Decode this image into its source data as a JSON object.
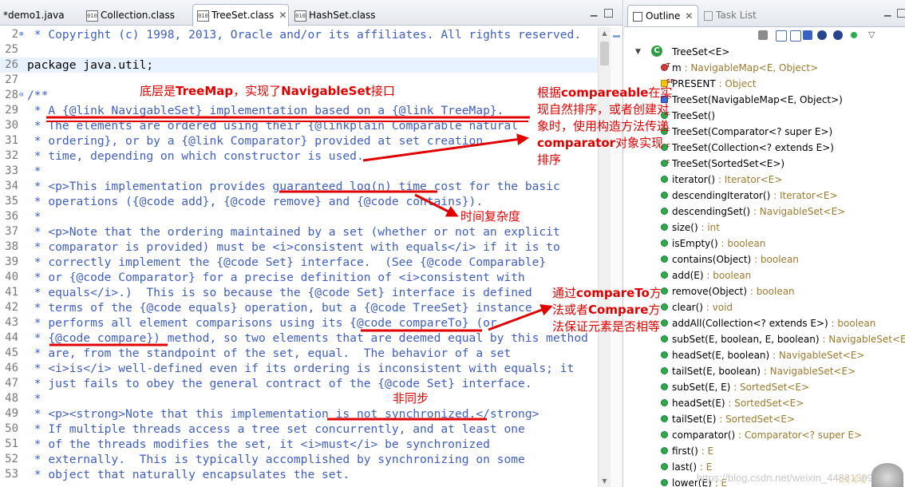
{
  "editor": {
    "tabs": [
      {
        "label": "*demo1.java",
        "icon": "java-file-icon",
        "active": false
      },
      {
        "label": "Collection.class",
        "icon": "class-file-icon",
        "active": false
      },
      {
        "label": "TreeSet.class",
        "icon": "class-file-icon",
        "active": true
      },
      {
        "label": "HashSet.class",
        "icon": "class-file-icon",
        "active": false
      }
    ],
    "close_glyph": "✕",
    "lines": [
      {
        "num": "2",
        "text": " * Copyright (c) 1998, 2013, Oracle and/or its affiliates. All rights reserved.",
        "fold": "⊕"
      },
      {
        "num": "25",
        "text": ""
      },
      {
        "num": "26",
        "text": "package java.util;",
        "highlight": true
      },
      {
        "num": "27",
        "text": ""
      },
      {
        "num": "28",
        "text": "/**",
        "fold": "⊖"
      },
      {
        "num": "29",
        "text": " * A {@link NavigableSet} implementation based on a {@link TreeMap}."
      },
      {
        "num": "30",
        "text": " * The elements are ordered using their {@linkplain Comparable natural"
      },
      {
        "num": "31",
        "text": " * ordering}, or by a {@link Comparator} provided at set creation"
      },
      {
        "num": "32",
        "text": " * time, depending on which constructor is used."
      },
      {
        "num": "33",
        "text": " *"
      },
      {
        "num": "34",
        "text": " * <p>This implementation provides guaranteed log(n) time cost for the basic"
      },
      {
        "num": "35",
        "text": " * operations ({@code add}, {@code remove} and {@code contains})."
      },
      {
        "num": "36",
        "text": " *"
      },
      {
        "num": "37",
        "text": " * <p>Note that the ordering maintained by a set (whether or not an explicit"
      },
      {
        "num": "38",
        "text": " * comparator is provided) must be <i>consistent with equals</i> if it is to"
      },
      {
        "num": "39",
        "text": " * correctly implement the {@code Set} interface.  (See {@code Comparable}"
      },
      {
        "num": "40",
        "text": " * or {@code Comparator} for a precise definition of <i>consistent with"
      },
      {
        "num": "41",
        "text": " * equals</i>.)  This is so because the {@code Set} interface is defined"
      },
      {
        "num": "42",
        "text": " * terms of the {@code equals} operation, but a {@code TreeSet} instance"
      },
      {
        "num": "43",
        "text": " * performs all element comparisons using its {@code compareTo} (or"
      },
      {
        "num": "44",
        "text": " * {@code compare}) method, so two elements that are deemed equal by this method"
      },
      {
        "num": "45",
        "text": " * are, from the standpoint of the set, equal.  The behavior of a set"
      },
      {
        "num": "46",
        "text": " * <i>is</i> well-defined even if its ordering is inconsistent with equals; it"
      },
      {
        "num": "47",
        "text": " * just fails to obey the general contract of the {@code Set} interface."
      },
      {
        "num": "48",
        "text": " *"
      },
      {
        "num": "49",
        "text": " * <p><strong>Note that this implementation is not synchronized.</strong>"
      },
      {
        "num": "50",
        "text": " * If multiple threads access a tree set concurrently, and at least one"
      },
      {
        "num": "51",
        "text": " * of the threads modifies the set, it <i>must</i> be synchronized"
      },
      {
        "num": "52",
        "text": " * externally.  This is typically accomplished by synchronizing on some"
      },
      {
        "num": "53",
        "text": " * object that naturally encapsulates the set."
      }
    ]
  },
  "outline": {
    "tabs": [
      {
        "label": "Outline",
        "active": true
      },
      {
        "label": "Task List",
        "active": false
      }
    ],
    "class_label": "TreeSet<E>",
    "items": [
      {
        "name": "m",
        "type": " : NavigableMap<E, Object>",
        "icon": "private-field-icon",
        "mod": "T"
      },
      {
        "name": "PRESENT",
        "type": " : Object",
        "icon": "static-final-field-icon",
        "mod": "SF"
      },
      {
        "name": "TreeSet(NavigableMap<E, Object>)",
        "type": "",
        "icon": "package-constructor-icon",
        "mod": "c"
      },
      {
        "name": "TreeSet()",
        "type": "",
        "icon": "public-constructor-icon",
        "mod": "c"
      },
      {
        "name": "TreeSet(Comparator<? super E>)",
        "type": "",
        "icon": "public-constructor-icon",
        "mod": "c"
      },
      {
        "name": "TreeSet(Collection<? extends E>)",
        "type": "",
        "icon": "public-constructor-icon",
        "mod": "c"
      },
      {
        "name": "TreeSet(SortedSet<E>)",
        "type": "",
        "icon": "public-constructor-icon",
        "mod": "c"
      },
      {
        "name": "iterator()",
        "type": " : Iterator<E>",
        "icon": "public-method-icon",
        "mod": ""
      },
      {
        "name": "descendingIterator()",
        "type": " : Iterator<E>",
        "icon": "public-method-icon",
        "mod": ""
      },
      {
        "name": "descendingSet()",
        "type": " : NavigableSet<E>",
        "icon": "public-method-icon",
        "mod": ""
      },
      {
        "name": "size()",
        "type": " : int",
        "icon": "public-method-icon",
        "mod": ""
      },
      {
        "name": "isEmpty()",
        "type": " : boolean",
        "icon": "public-method-icon",
        "mod": ""
      },
      {
        "name": "contains(Object)",
        "type": " : boolean",
        "icon": "public-method-icon",
        "mod": ""
      },
      {
        "name": "add(E)",
        "type": " : boolean",
        "icon": "public-method-icon",
        "mod": ""
      },
      {
        "name": "remove(Object)",
        "type": " : boolean",
        "icon": "public-method-icon",
        "mod": ""
      },
      {
        "name": "clear()",
        "type": " : void",
        "icon": "public-method-icon",
        "mod": ""
      },
      {
        "name": "addAll(Collection<? extends E>)",
        "type": " : boolean",
        "icon": "public-method-icon",
        "mod": ""
      },
      {
        "name": "subSet(E, boolean, E, boolean)",
        "type": " : NavigableSet<E>",
        "icon": "public-method-icon",
        "mod": ""
      },
      {
        "name": "headSet(E, boolean)",
        "type": " : NavigableSet<E>",
        "icon": "public-method-icon",
        "mod": ""
      },
      {
        "name": "tailSet(E, boolean)",
        "type": " : NavigableSet<E>",
        "icon": "public-method-icon",
        "mod": ""
      },
      {
        "name": "subSet(E, E)",
        "type": " : SortedSet<E>",
        "icon": "public-method-icon",
        "mod": ""
      },
      {
        "name": "headSet(E)",
        "type": " : SortedSet<E>",
        "icon": "public-method-icon",
        "mod": ""
      },
      {
        "name": "tailSet(E)",
        "type": " : SortedSet<E>",
        "icon": "public-method-icon",
        "mod": ""
      },
      {
        "name": "comparator()",
        "type": " : Comparator<? super E>",
        "icon": "public-method-icon",
        "mod": ""
      },
      {
        "name": "first()",
        "type": " : E",
        "icon": "public-method-icon",
        "mod": ""
      },
      {
        "name": "last()",
        "type": " : E",
        "icon": "public-method-icon",
        "mod": ""
      },
      {
        "name": "lower(E)",
        "type": " : E",
        "icon": "public-method-icon",
        "mod": ""
      }
    ],
    "watermark": "https://blog.csdn.net/weixin_44861399"
  },
  "annotations": {
    "treemap_note": [
      {
        "t": "底层是",
        "b": false
      },
      {
        "t": "TreeMap",
        "b": true
      },
      {
        "t": "，实现了",
        "b": false
      },
      {
        "t": "NavigableSet",
        "b": true
      },
      {
        "t": "接口",
        "b": false
      }
    ],
    "comparator_note": [
      {
        "t": "根据",
        "b": false
      },
      {
        "t": "compareable",
        "b": true
      },
      {
        "t": "在实现自然排序，或者创建对象时，使用构造方法传递",
        "b": false
      },
      {
        "t": "comparator",
        "b": true
      },
      {
        "t": "对象实现排序",
        "b": false
      }
    ],
    "complexity_note": [
      {
        "t": "时间复杂度",
        "b": false
      }
    ],
    "equality_note": [
      {
        "t": "通过",
        "b": false
      },
      {
        "t": "compareTo",
        "b": true
      },
      {
        "t": "方法或者",
        "b": false
      },
      {
        "t": "Compare",
        "b": true
      },
      {
        "t": "方法保证元素是否相等",
        "b": false
      }
    ],
    "sync_note": [
      {
        "t": "非同步",
        "b": false
      }
    ],
    "color": "#e10000"
  }
}
